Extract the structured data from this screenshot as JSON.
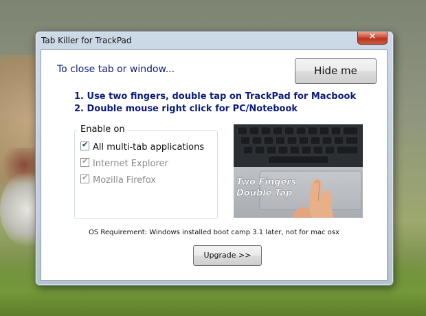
{
  "window": {
    "title": "Tab Killer for TrackPad",
    "close_glyph": "✕"
  },
  "main": {
    "heading": "To close tab or window...",
    "hide_button": "Hide me",
    "instruction_1": "1. Use two fingers, double tap on TrackPad for Macbook",
    "instruction_2": "2. Double mouse right click for PC/Notebook"
  },
  "enable_group": {
    "legend": "Enable on",
    "options": [
      {
        "label": "All multi-tab applications",
        "checked": true,
        "enabled": true
      },
      {
        "label": "Internet Explorer",
        "checked": true,
        "enabled": false
      },
      {
        "label": "Mozilla Firefox",
        "checked": true,
        "enabled": false
      }
    ]
  },
  "image": {
    "caption_line1": "Two Fingers",
    "caption_line2": "Double Tap"
  },
  "footer": {
    "requirement": "OS Requirement: Windows installed boot camp 3.1 later, not for mac osx",
    "upgrade_button": "Upgrade >>"
  },
  "colors": {
    "heading_text": "#0b1b80",
    "close_button": "#c8442c"
  },
  "icons": {
    "close": "close-icon",
    "checkbox": "checkmark-icon"
  }
}
